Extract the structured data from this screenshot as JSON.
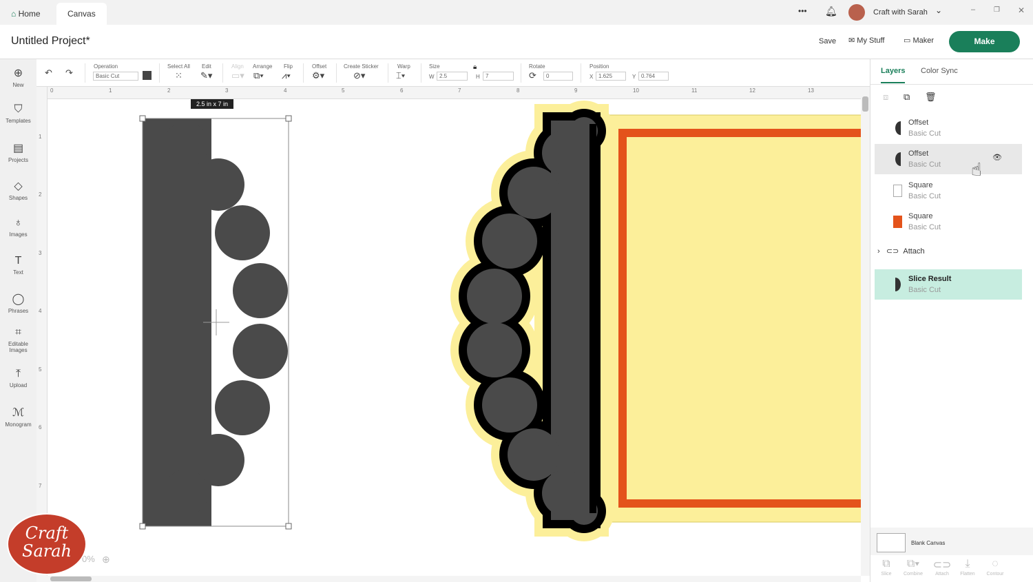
{
  "topbar": {
    "tabs": [
      "Home",
      "Canvas"
    ],
    "user": "Craft with Sarah",
    "more": "•••"
  },
  "header": {
    "title": "Untitled Project*",
    "save": "Save",
    "my_stuff": "My Stuff",
    "maker": "Maker",
    "make": "Make"
  },
  "toolbar": {
    "operation_label": "Operation",
    "operation_value": "Basic Cut",
    "select_all": "Select All",
    "edit": "Edit",
    "align": "Align",
    "arrange": "Arrange",
    "flip": "Flip",
    "offset": "Offset",
    "create_sticker": "Create Sticker",
    "warp": "Warp",
    "size": "Size",
    "w_label": "W",
    "w": "2.5",
    "h_label": "H",
    "h": "7",
    "rotate": "Rotate",
    "rotate_value": "0",
    "position": "Position",
    "x_label": "X",
    "x": "1.625",
    "y_label": "Y",
    "y": "0.764"
  },
  "nav": [
    "New",
    "Templates",
    "Projects",
    "Shapes",
    "Images",
    "Text",
    "Phrases",
    "Editable Images",
    "Upload",
    "Monogram"
  ],
  "ruler_top": [
    "0",
    "1",
    "2",
    "3",
    "4",
    "5",
    "6",
    "7",
    "8",
    "9",
    "10",
    "11",
    "12",
    "13"
  ],
  "ruler_left": [
    "1",
    "2",
    "3",
    "4",
    "5",
    "6",
    "7"
  ],
  "canvas": {
    "size_tooltip": "2.5  in x 7  in",
    "zoom": "0%"
  },
  "panel": {
    "tabs": [
      "Layers",
      "Color Sync"
    ],
    "layers": [
      {
        "name": "Offset",
        "sub": "Basic Cut"
      },
      {
        "name": "Offset",
        "sub": "Basic Cut"
      },
      {
        "name": "Square",
        "sub": "Basic Cut"
      },
      {
        "name": "Square",
        "sub": "Basic Cut"
      }
    ],
    "group": "Attach",
    "result": {
      "name": "Slice Result",
      "sub": "Basic Cut"
    },
    "blank_canvas": "Blank Canvas",
    "bottom": [
      "Slice",
      "Combine",
      "Attach",
      "Flatten",
      "Contour"
    ]
  },
  "logo": {
    "text": "Craft with Sarah"
  },
  "colors": {
    "accent": "#1a7f5a",
    "orange": "#e4531b",
    "yellow": "#fcef9a",
    "shape": "#4a4a4a",
    "selected": "#c7ede0"
  }
}
